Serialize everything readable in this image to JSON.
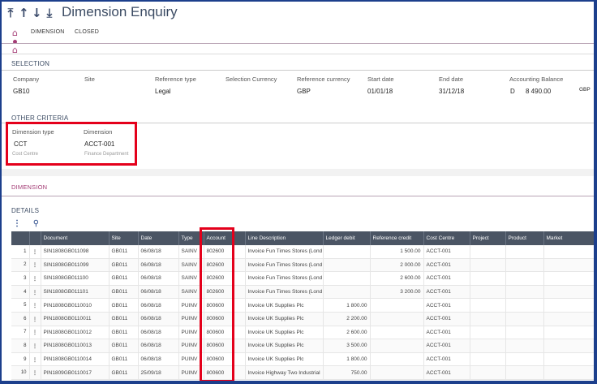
{
  "window": {
    "title": "Dimension Enquiry"
  },
  "toolbar": {
    "arrow_first": "⤒",
    "arrow_up": "↑",
    "arrow_down": "↓",
    "arrow_last": "⤓"
  },
  "tabs": [
    {
      "label": "DIMENSION"
    },
    {
      "label": "CLOSED"
    }
  ],
  "selection": {
    "title": "SELECTION",
    "fields": [
      {
        "label": "Company",
        "value": "GB10"
      },
      {
        "label": "Site",
        "value": ""
      },
      {
        "label": "Reference type",
        "value": "Legal"
      },
      {
        "label": "Selection Currency",
        "value": ""
      },
      {
        "label": "Reference currency",
        "value": "GBP"
      },
      {
        "label": "Start date",
        "value": "01/01/18"
      },
      {
        "label": "End date",
        "value": "31/12/18"
      },
      {
        "label": "Accounting Balance",
        "value_sign": "D",
        "value": "8 490.00",
        "currency": "GBP"
      }
    ]
  },
  "other_criteria": {
    "title": "OTHER CRITERIA",
    "dimension_type": {
      "label": "Dimension type",
      "value": "CCT",
      "description": "Cost Centre"
    },
    "dimension": {
      "label": "Dimension",
      "value": "ACCT-001",
      "description": "Finance Department"
    }
  },
  "dimension_section": {
    "title": "DIMENSION"
  },
  "details": {
    "title": "DETAILS",
    "menu_glyph": "⋮",
    "columns": [
      "Document",
      "Site",
      "Date",
      "Type",
      "Account",
      "Line Description",
      "Ledger debit",
      "Reference credit",
      "Cost Centre",
      "Project",
      "Product",
      "Market"
    ],
    "rows": [
      {
        "n": "1",
        "document": "SIN1808GB011098",
        "site": "GB011",
        "date": "06/08/18",
        "type": "SAINV",
        "account": "802600",
        "desc": "Invoice Fun Times Stores (Lond",
        "debit": "",
        "credit": "1 500.00",
        "cc": "ACCT-001"
      },
      {
        "n": "2",
        "document": "SIN1808GB011099",
        "site": "GB011",
        "date": "06/08/18",
        "type": "SAINV",
        "account": "802600",
        "desc": "Invoice Fun Times Stores (Lond",
        "debit": "",
        "credit": "2 000.00",
        "cc": "ACCT-001"
      },
      {
        "n": "3",
        "document": "SIN1808GB011100",
        "site": "GB011",
        "date": "06/08/18",
        "type": "SAINV",
        "account": "802600",
        "desc": "Invoice Fun Times Stores (Lond",
        "debit": "",
        "credit": "2 600.00",
        "cc": "ACCT-001"
      },
      {
        "n": "4",
        "document": "SIN1808GB011101",
        "site": "GB011",
        "date": "06/08/18",
        "type": "SAINV",
        "account": "802600",
        "desc": "Invoice Fun Times Stores (Lond",
        "debit": "",
        "credit": "3 200.00",
        "cc": "ACCT-001"
      },
      {
        "n": "5",
        "document": "PIN1808GB0110010",
        "site": "GB011",
        "date": "06/08/18",
        "type": "PUINV",
        "account": "800600",
        "desc": "Invoice UK Supplies Plc",
        "debit": "1 800.00",
        "credit": "",
        "cc": "ACCT-001"
      },
      {
        "n": "6",
        "document": "PIN1808GB0110011",
        "site": "GB011",
        "date": "06/08/18",
        "type": "PUINV",
        "account": "800600",
        "desc": "Invoice UK Supplies Plc",
        "debit": "2 200.00",
        "credit": "",
        "cc": "ACCT-001"
      },
      {
        "n": "7",
        "document": "PIN1808GB0110012",
        "site": "GB011",
        "date": "06/08/18",
        "type": "PUINV",
        "account": "800600",
        "desc": "Invoice UK Supplies Plc",
        "debit": "2 600.00",
        "credit": "",
        "cc": "ACCT-001"
      },
      {
        "n": "8",
        "document": "PIN1808GB0110013",
        "site": "GB011",
        "date": "06/08/18",
        "type": "PUINV",
        "account": "800600",
        "desc": "Invoice UK Supplies Plc",
        "debit": "3 500.00",
        "credit": "",
        "cc": "ACCT-001"
      },
      {
        "n": "9",
        "document": "PIN1808GB0110014",
        "site": "GB011",
        "date": "06/08/18",
        "type": "PUINV",
        "account": "800600",
        "desc": "Invoice UK Supplies Plc",
        "debit": "1 800.00",
        "credit": "",
        "cc": "ACCT-001"
      },
      {
        "n": "10",
        "document": "PIN1809GB0110017",
        "site": "GB011",
        "date": "25/09/18",
        "type": "PUINV",
        "account": "800600",
        "desc": "Invoice Highway Two Industrial",
        "debit": "750.00",
        "credit": "",
        "cc": "ACCT-001"
      }
    ]
  },
  "colors": {
    "accent": "#a33a74",
    "highlight_box": "#e4001b",
    "grid_header": "#4b5564",
    "frame": "#1c3f8c"
  }
}
